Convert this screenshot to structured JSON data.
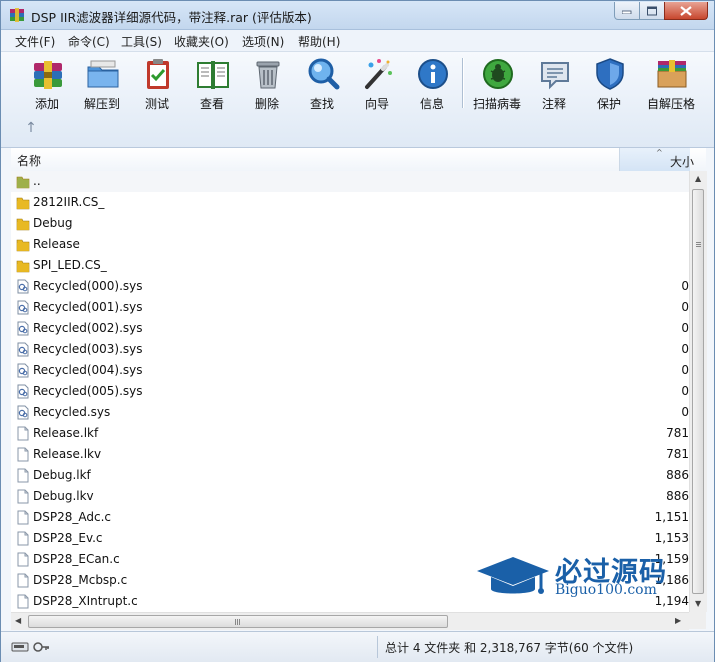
{
  "window": {
    "title": "DSP IIR滤波器详细源代码，带注释.rar (评估版本)"
  },
  "menu": [
    "文件(F)",
    "命令(C)",
    "工具(S)",
    "收藏夹(O)",
    "选项(N)",
    "帮助(H)"
  ],
  "toolbar": [
    {
      "label": "添加",
      "icon": "add-icon"
    },
    {
      "label": "解压到",
      "icon": "extract-to-icon"
    },
    {
      "label": "测试",
      "icon": "test-icon"
    },
    {
      "label": "查看",
      "icon": "view-icon"
    },
    {
      "label": "删除",
      "icon": "delete-icon"
    },
    {
      "label": "查找",
      "icon": "find-icon"
    },
    {
      "label": "向导",
      "icon": "wizard-icon"
    },
    {
      "label": "信息",
      "icon": "info-icon"
    },
    {
      "label": "扫描病毒",
      "icon": "scan-virus-icon"
    },
    {
      "label": "注释",
      "icon": "comment-icon"
    },
    {
      "label": "保护",
      "icon": "protect-icon"
    },
    {
      "label": "自解压格",
      "icon": "sfx-icon"
    }
  ],
  "columns": {
    "name": "名称",
    "size": "大小"
  },
  "files": [
    {
      "name": "..",
      "size": "",
      "type": "parent"
    },
    {
      "name": "2812IIR.CS_",
      "size": "",
      "type": "folder"
    },
    {
      "name": "Debug",
      "size": "",
      "type": "folder"
    },
    {
      "name": "Release",
      "size": "",
      "type": "folder"
    },
    {
      "name": "SPI_LED.CS_",
      "size": "",
      "type": "folder"
    },
    {
      "name": "Recycled(000).sys",
      "size": "0",
      "type": "sys"
    },
    {
      "name": "Recycled(001).sys",
      "size": "0",
      "type": "sys"
    },
    {
      "name": "Recycled(002).sys",
      "size": "0",
      "type": "sys"
    },
    {
      "name": "Recycled(003).sys",
      "size": "0",
      "type": "sys"
    },
    {
      "name": "Recycled(004).sys",
      "size": "0",
      "type": "sys"
    },
    {
      "name": "Recycled(005).sys",
      "size": "0",
      "type": "sys"
    },
    {
      "name": "Recycled.sys",
      "size": "0",
      "type": "sys"
    },
    {
      "name": "Release.lkf",
      "size": "781",
      "type": "file"
    },
    {
      "name": "Release.lkv",
      "size": "781",
      "type": "file"
    },
    {
      "name": "Debug.lkf",
      "size": "886",
      "type": "file"
    },
    {
      "name": "Debug.lkv",
      "size": "886",
      "type": "file"
    },
    {
      "name": "DSP28_Adc.c",
      "size": "1,151",
      "type": "file"
    },
    {
      "name": "DSP28_Ev.c",
      "size": "1,153",
      "type": "file"
    },
    {
      "name": "DSP28_ECan.c",
      "size": "1,159",
      "type": "file"
    },
    {
      "name": "DSP28_Mcbsp.c",
      "size": "1,186",
      "type": "file"
    },
    {
      "name": "DSP28_XIntrupt.c",
      "size": "1,194",
      "type": "file"
    }
  ],
  "status": {
    "text": "总计 4 文件夹 和 2,318,767 字节(60 个文件)"
  },
  "watermark": {
    "title": "必过源码",
    "subtitle": "Biguo100.com"
  },
  "colors": {
    "accent": "#1a60a8",
    "titlebar": "#c3d7ee",
    "folder": "#e8b923"
  }
}
